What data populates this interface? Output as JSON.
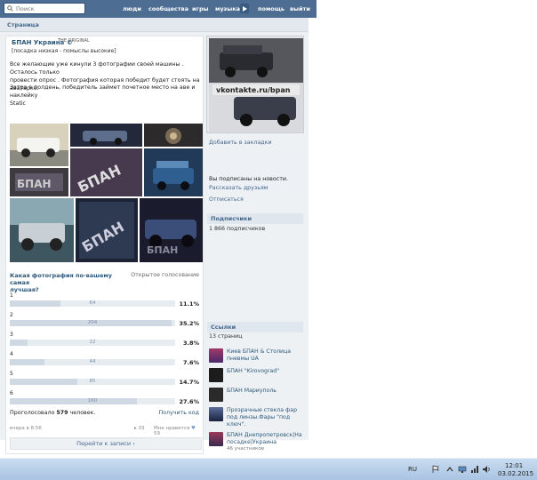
{
  "topbar": {
    "search_placeholder": "Поиск",
    "nav": [
      "люди",
      "сообщества",
      "игры",
      "музыка",
      "помощь",
      "выйти"
    ]
  },
  "page": {
    "header": "Страница"
  },
  "post": {
    "group_name": "БПАН Украина ©",
    "group_copy": "THE ORIGINAL",
    "group_sub": "[посадка низкая - помыслы высокие]",
    "text1_line1": "Все желающие уже кинули 3 фотографии своей машины . Осталось только",
    "text1_line2": "провести опрос . Фотография которая победит будет стоять на аватарке.",
    "text2_line1": "Затра в полдень, победитель займет почетное место на аве и наклейку",
    "text2_line2": "Static",
    "poll_question_line1": "Какая фотография по-вашему самая",
    "poll_question_line2": "лучшая?",
    "poll_type": "Открытое голосование",
    "options": [
      {
        "label": "1",
        "count": "64",
        "pct": "11.1%",
        "fraction": 0.111
      },
      {
        "label": "2",
        "count": "204",
        "pct": "35.2%",
        "fraction": 0.352
      },
      {
        "label": "3",
        "count": "22",
        "pct": "3.8%",
        "fraction": 0.038
      },
      {
        "label": "4",
        "count": "44",
        "pct": "7.6%",
        "fraction": 0.076
      },
      {
        "label": "5",
        "count": "85",
        "pct": "14.7%",
        "fraction": 0.147
      },
      {
        "label": "6",
        "count": "160",
        "pct": "27.6%",
        "fraction": 0.276
      }
    ],
    "voted_prefix": "Проголосовало",
    "voted_count": "579",
    "voted_suffix": "человек.",
    "get_code": "Получить код",
    "time": "вчера в 8:56",
    "reposts": "33",
    "likes_label": "Мне нравится",
    "likes": "59",
    "goto": "Перейти к записи"
  },
  "sidebar": {
    "cover_text": "vkontakte.ru/bpan",
    "bookmark": "Добавить в закладки",
    "subscribed": "Вы подписаны на новости.",
    "tell_friends": "Рассказать друзьям",
    "unsubscribe": "Отписаться",
    "subscribers_head": "Подписчики",
    "subscribers_count": "1 866 подписчиков",
    "links_head": "Ссылки",
    "links_count": "13 страниц",
    "links": [
      {
        "title": "Киев БПАН & Столица пневмы UA",
        "sub": ""
      },
      {
        "title": "БПАН \"Kirovograd\"",
        "sub": ""
      },
      {
        "title": "БПАН Мариуполь",
        "sub": ""
      },
      {
        "title": "Прозрачные стекла фар под линзы.Фары \"под ключ\".",
        "sub": ""
      },
      {
        "title": "БПАН Днепропетровск|На посадке|Украина",
        "sub": "46 участников"
      }
    ]
  },
  "taskbar": {
    "lang": "RU",
    "time": "12:01",
    "date": "03.02.2015"
  }
}
